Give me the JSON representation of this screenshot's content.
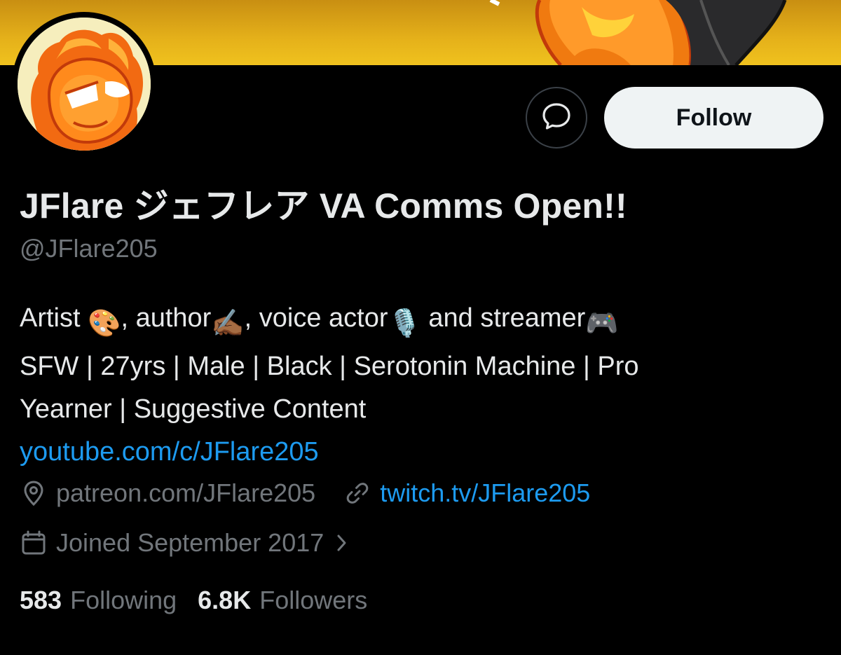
{
  "profile": {
    "display_name": "JFlare ジェフレア VA Comms Open!!",
    "handle": "@JFlare205",
    "follow_label": "Follow",
    "message_icon": "message-bubble-icon",
    "bio": {
      "line1": {
        "t1": "Artist ",
        "e1": "🎨",
        "t2": ", author",
        "e2": "✍🏾",
        "t3": ", voice actor",
        "e3": "🎙️",
        "t4": " and streamer",
        "e4": "🎮"
      },
      "line2": "SFW | 27yrs | Male | Black | Serotonin Machine | Pro",
      "line3": "Yearner | Suggestive Content",
      "link": "youtube.com/c/JFlare205"
    },
    "location": "patreon.com/JFlare205",
    "website": "twitch.tv/JFlare205",
    "joined": "Joined September 2017",
    "stats": {
      "following_count": "583",
      "following_label": "Following",
      "followers_count": "6.8K",
      "followers_label": "Followers"
    }
  },
  "colors": {
    "background": "#000000",
    "text": "#e7e9ea",
    "muted": "#71767b",
    "link": "#1d9bf0",
    "banner": "#e5b11a",
    "follow_bg": "#eff3f4"
  }
}
